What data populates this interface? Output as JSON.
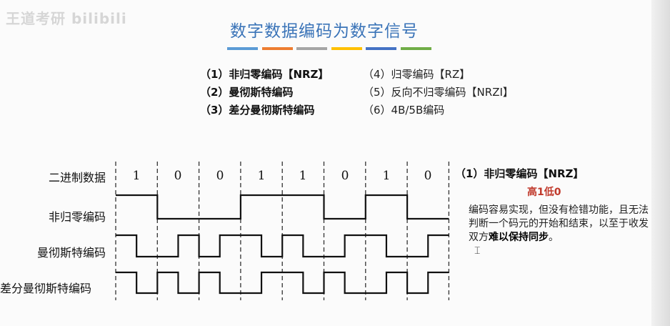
{
  "watermark": "王道考研 bilibili",
  "title": "数字数据编码为数字信号",
  "title_bar_colors": [
    "#5b9bd5",
    "#ed7d31",
    "#a5a5a5",
    "#ffc000",
    "#4472c4",
    "#70ad47"
  ],
  "list_left": [
    "（1）非归零编码【NRZ】",
    "（2）曼彻斯特编码",
    "（3）差分曼彻斯特编码"
  ],
  "list_right": [
    "（4）归零编码【RZ】",
    "（5）反向不归零编码【NRZI】",
    "（6）4B/5B编码"
  ],
  "diagram": {
    "row_labels": {
      "binary": "二进制数据",
      "nrz": "非归零编码",
      "manchester": "曼彻斯特编码",
      "diff_manchester": "差分曼彻斯特编码"
    },
    "bits": [
      "1",
      "0",
      "0",
      "1",
      "1",
      "0",
      "1",
      "0"
    ]
  },
  "panel": {
    "heading": "（1）非归零编码【NRZ】",
    "subheading": "高1低0",
    "text_plain": "编码容易实现，但没有检错功能，且无法判断一个码元的开始和结束，以至于收发双方",
    "text_bold": "难以保持同步",
    "text_end": "。"
  }
}
